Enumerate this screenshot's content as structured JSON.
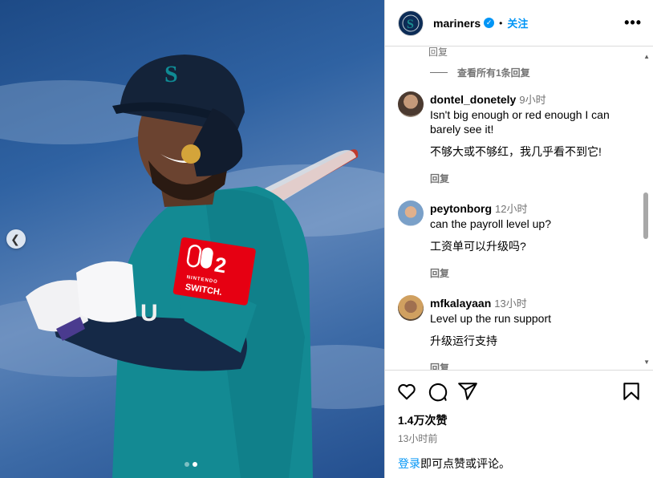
{
  "post": {
    "username": "mariners",
    "separator": "•",
    "follow_label": "关注",
    "more_label": "•••",
    "carousel": {
      "total": 2,
      "current": 2
    },
    "patch_brand": "NINTENDO",
    "patch_product": "SWITCH.",
    "patch_number": "2"
  },
  "comments": {
    "top_reply_label": "回复",
    "view_all_label": "查看所有1条回复",
    "items": [
      {
        "user": "dontel_donetely",
        "time": "9小时",
        "text": "Isn't big enough or red enough I can barely see it!",
        "translation": "不够大或不够红，我几乎看不到它!",
        "reply_label": "回复"
      },
      {
        "user": "peytonborg",
        "time": "12小时",
        "text": "can the payroll level up?",
        "translation": "工资单可以升级吗?",
        "reply_label": "回复"
      },
      {
        "user": "mfkalayaan",
        "time": "13小时",
        "text": "Level up the run support",
        "translation": "升级运行支持",
        "reply_label": "回复"
      }
    ]
  },
  "footer": {
    "likes": "1.4万次赞",
    "time_ago": "13小时前",
    "login_link": "登录",
    "login_text": "即可点赞或评论。"
  },
  "icons": [
    "mariners-logo-icon",
    "verified-badge-icon",
    "chevron-left-icon",
    "heart-icon",
    "comment-icon",
    "share-icon",
    "bookmark-icon"
  ],
  "colors": {
    "accent": "#0095f6",
    "team_navy": "#0c2c56",
    "team_teal": "#0f8a94",
    "patch_red": "#e60012"
  }
}
